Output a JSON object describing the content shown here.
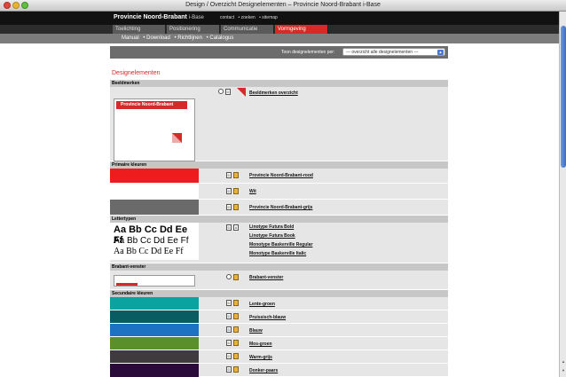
{
  "window": {
    "title": "Design / Overzicht Designelementen – Provincie Noord-Brabant i-Base"
  },
  "header": {
    "brand": "Provincie Noord-Brabant",
    "brand_sub": "i-Base",
    "links": [
      "contact",
      "• zoeken",
      "• sitemap"
    ]
  },
  "tabs": [
    {
      "label": "Toelichting",
      "active": false
    },
    {
      "label": "Positionering",
      "active": false
    },
    {
      "label": "Communicatie",
      "active": false
    },
    {
      "label": "Vormgeving",
      "active": true
    }
  ],
  "subnav": [
    "Manual",
    "• Download",
    "• Richtlijnen",
    "• Catalogus"
  ],
  "filter": {
    "label": "Toon designelementen per:",
    "selected": "--- overzicht alle designelementen ---"
  },
  "page_title": "Designelementen",
  "sections": {
    "beeldmerken": {
      "title": "Beeldmerken",
      "logo_text": "Provincie Noord-Brabant",
      "link": "Beeldmerken overzicht"
    },
    "primaire": {
      "title": "Primaire kleuren",
      "items": [
        {
          "label": "Provincie Noord-Brabant-rood",
          "color": "#ee1c1c"
        },
        {
          "label": "Wit",
          "color": "#ffffff"
        },
        {
          "label": "Provincie Noord-Brabant-grijs",
          "color": "#6a6a6a"
        }
      ]
    },
    "lettertypen": {
      "title": "Lettertypen",
      "samples": [
        "Aa Bb Cc Dd Ee Ff",
        "Aa Bb Cc Dd Ee Ff",
        "Aa Bb Cc Dd Ee Ff"
      ],
      "links": [
        "Linotype Futura Bold",
        "Linotype Futura Book",
        "Monotype Baskerville Regular",
        "Monotype Baskerville Italic"
      ]
    },
    "venster": {
      "title": "Brabant-venster",
      "link": "Brabant-venster"
    },
    "secundaire": {
      "title": "Secundaire kleuren",
      "items": [
        {
          "label": "Lente-groen",
          "color": "#0aa3a0"
        },
        {
          "label": "Pruissisch-blauw",
          "color": "#0a5c63"
        },
        {
          "label": "Blauw",
          "color": "#1e72c2"
        },
        {
          "label": "Mos-groen",
          "color": "#5a8f2a"
        },
        {
          "label": "Warm-grijs",
          "color": "#3f3a3e"
        },
        {
          "label": "Donker-paars",
          "color": "#2a0a38"
        }
      ]
    }
  },
  "icons": {
    "search": "magnifier-icon",
    "doc": "document-icon",
    "folder": "folder-download-icon",
    "font": "font-file-icon"
  },
  "colors": {
    "accent": "#d42a2a",
    "header": "#111111",
    "section": "#c7c7c7",
    "row": "#e6e6e6"
  }
}
